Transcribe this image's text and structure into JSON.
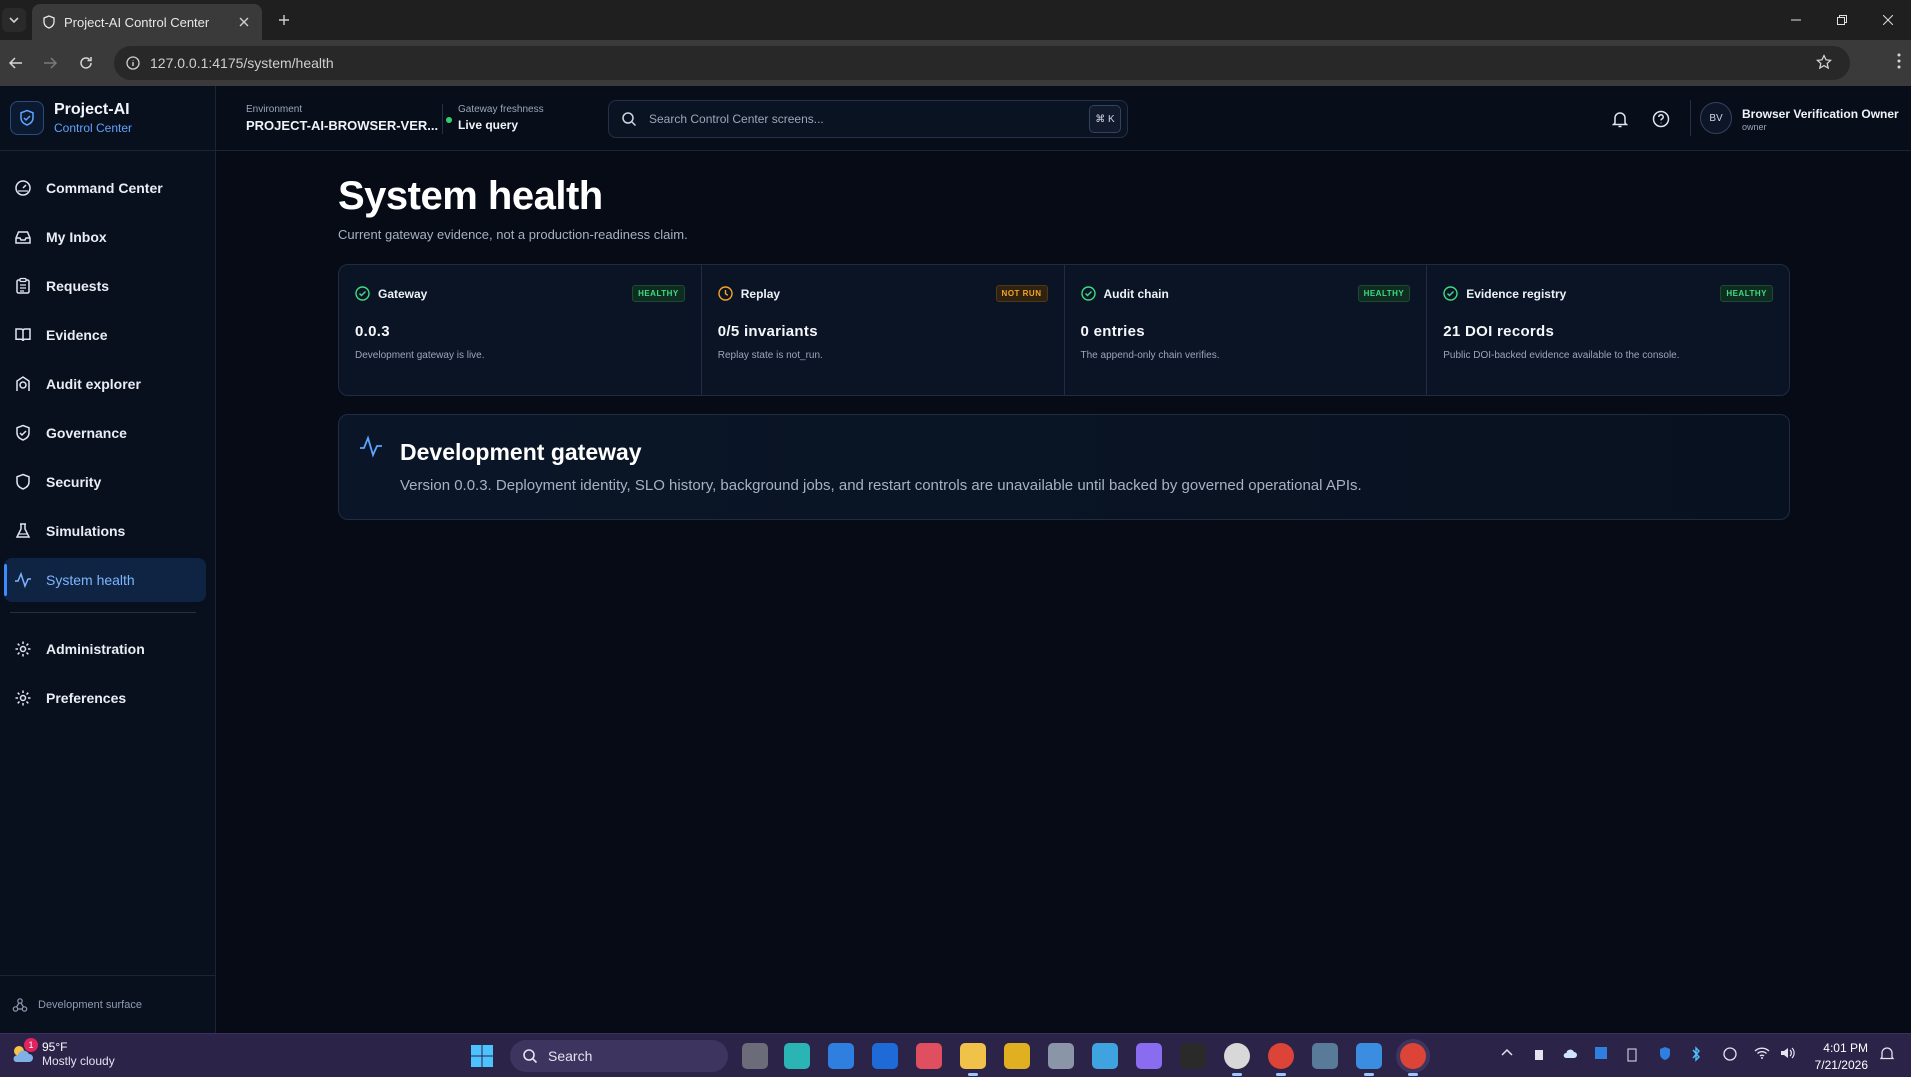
{
  "browser": {
    "tab_title": "Project-AI Control Center",
    "url": "127.0.0.1:4175/system/health"
  },
  "brand": {
    "name": "Project-AI",
    "subtitle": "Control Center"
  },
  "sidebar": {
    "items": [
      {
        "label": "Command Center",
        "icon": "command-center-icon"
      },
      {
        "label": "My Inbox",
        "icon": "inbox-icon"
      },
      {
        "label": "Requests",
        "icon": "clipboard-icon"
      },
      {
        "label": "Evidence",
        "icon": "book-icon"
      },
      {
        "label": "Audit explorer",
        "icon": "audit-icon"
      },
      {
        "label": "Governance",
        "icon": "shield-check-icon"
      },
      {
        "label": "Security",
        "icon": "shield-icon"
      },
      {
        "label": "Simulations",
        "icon": "flask-icon"
      },
      {
        "label": "System health",
        "icon": "activity-icon",
        "active": true
      }
    ],
    "secondary": [
      {
        "label": "Administration",
        "icon": "gear-icon"
      },
      {
        "label": "Preferences",
        "icon": "gear-icon"
      }
    ],
    "footer": "Development surface"
  },
  "topbar": {
    "environment_caption": "Environment",
    "environment_value": "PROJECT-AI-BROWSER-VER...",
    "freshness_caption": "Gateway freshness",
    "freshness_value": "Live query",
    "search_placeholder": "Search Control Center screens...",
    "search_shortcut": "⌘ K",
    "user_initials": "BV",
    "user_name": "Browser Verification Owner",
    "user_role": "owner"
  },
  "page": {
    "title": "System health",
    "subtitle": "Current gateway evidence, not a production-readiness claim."
  },
  "cards": [
    {
      "title": "Gateway",
      "badge": "HEALTHY",
      "status": "ok",
      "value": "0.0.3",
      "desc": "Development gateway is live."
    },
    {
      "title": "Replay",
      "badge": "NOT RUN",
      "status": "warn",
      "value": "0/5 invariants",
      "desc": "Replay state is not_run."
    },
    {
      "title": "Audit chain",
      "badge": "HEALTHY",
      "status": "ok",
      "value": "0 entries",
      "desc": "The append-only chain verifies."
    },
    {
      "title": "Evidence registry",
      "badge": "HEALTHY",
      "status": "ok",
      "value": "21 DOI records",
      "desc": "Public DOI-backed evidence available to the console."
    }
  ],
  "gateway_panel": {
    "title": "Development gateway",
    "text": "Version 0.0.3. Deployment identity, SLO history, background jobs, and restart controls are unavailable until backed by governed operational APIs."
  },
  "taskbar": {
    "weather_temp": "95°F",
    "weather_desc": "Mostly cloudy",
    "weather_badge": "1",
    "search_label": "Search",
    "time": "4:01 PM",
    "date": "7/21/2026"
  },
  "colors": {
    "accent": "#3b8cff",
    "healthy": "#3ddc84",
    "warning": "#f5a524",
    "background": "#060b16"
  }
}
